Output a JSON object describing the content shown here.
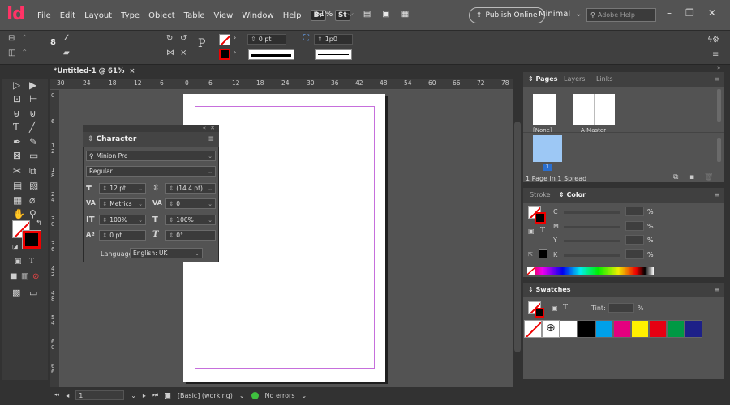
{
  "app": {
    "logo": "Id"
  },
  "menu": [
    "File",
    "Edit",
    "Layout",
    "Type",
    "Object",
    "Table",
    "View",
    "Window",
    "Help"
  ],
  "badges": [
    "Br",
    "St"
  ],
  "zoom": "61%",
  "publish_label": "Publish Online",
  "workspace_label": "Minimal",
  "help_placeholder": "Adobe Help",
  "control": {
    "stroke_weight": "0 pt",
    "gap_value": "1p0",
    "ref_point_label": "8"
  },
  "document_tab": "*Untitled-1 @ 61%",
  "document_tab_close": "×",
  "ruler": {
    "h_ticks": [
      "30",
      "24",
      "18",
      "12",
      "6",
      "0",
      "6",
      "12",
      "18",
      "24",
      "30",
      "36",
      "42",
      "48",
      "54",
      "60",
      "66",
      "72",
      "78"
    ],
    "v_ticks": [
      "0",
      "6",
      "1 2",
      "1 8",
      "2 4",
      "3 0",
      "3 6",
      "4 2",
      "4 8",
      "5 4",
      "6 0",
      "6 6"
    ]
  },
  "status": {
    "page": "1",
    "style": "[Basic] (working)",
    "errors": "No errors"
  },
  "character": {
    "title": "Character",
    "font_family": "Minion Pro",
    "font_style": "Regular",
    "size": "12 pt",
    "leading": "(14.4 pt)",
    "kerning": "Metrics",
    "tracking": "0",
    "vscale": "100%",
    "hscale": "100%",
    "baseline": "0 pt",
    "skew": "0°",
    "language_label": "Language:",
    "language": "English: UK"
  },
  "pages_panel": {
    "tabs": [
      "Pages",
      "Layers",
      "Links"
    ],
    "master_none": "[None]",
    "master_a": "A-Master",
    "page_number": "1",
    "footer": "1 Page in 1 Spread"
  },
  "color_panel": {
    "tabs": [
      "Stroke",
      "Color"
    ],
    "channels": [
      "C",
      "M",
      "Y",
      "K"
    ],
    "pct": "%"
  },
  "swatches_panel": {
    "title": "Swatches",
    "tint_label": "Tint:",
    "pct": "%",
    "colors": [
      "#ffffff",
      "#000000",
      "#00a0e9",
      "#e4007f",
      "#fff100",
      "#e60012",
      "#009944",
      "#1d2088"
    ]
  }
}
